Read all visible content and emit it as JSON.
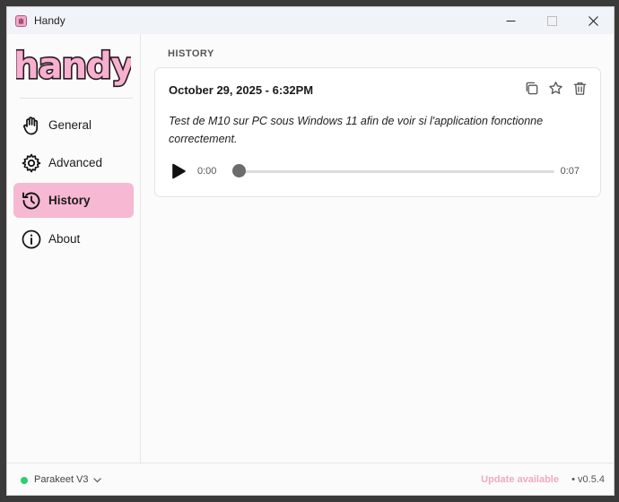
{
  "window": {
    "title": "Handy"
  },
  "sidebar": {
    "logo_text": "handy",
    "items": [
      {
        "label": "General",
        "icon": "hand-icon",
        "active": false
      },
      {
        "label": "Advanced",
        "icon": "cog-icon",
        "active": false
      },
      {
        "label": "History",
        "icon": "history-icon",
        "active": true
      },
      {
        "label": "About",
        "icon": "info-icon",
        "active": false
      }
    ]
  },
  "main": {
    "section_title": "HISTORY",
    "entry": {
      "date": "October 29, 2025 - 6:32PM",
      "text": "Test de M10 sur PC sous Windows 11 afin de voir si l'application fonctionne correctement.",
      "time_current": "0:00",
      "time_total": "0:07",
      "progress": 0,
      "actions": [
        "copy-icon",
        "star-icon",
        "trash-icon"
      ]
    }
  },
  "footer": {
    "model_name": "Parakeet V3",
    "model_status_color": "#2fcc71",
    "update_label": "Update available",
    "separator": "•",
    "version": "v0.5.4"
  },
  "colors": {
    "accent": "#f7b8d3",
    "update": "#f2a8c6"
  }
}
